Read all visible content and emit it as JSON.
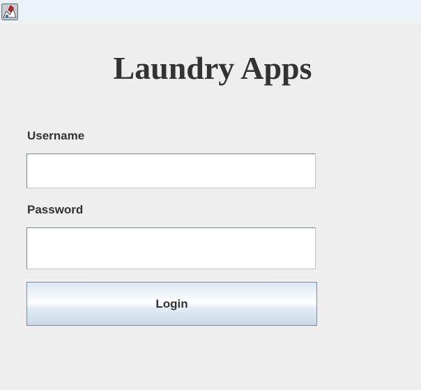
{
  "window": {
    "icon_name": "java-cup-icon"
  },
  "app": {
    "title": "Laundry Apps"
  },
  "form": {
    "username_label": "Username",
    "username_value": "",
    "password_label": "Password",
    "password_value": "",
    "login_label": "Login"
  },
  "colors": {
    "background": "#eeeeee",
    "titlebar": "#eaf3f7",
    "text": "#333333",
    "field_border": "#7a8a99"
  }
}
